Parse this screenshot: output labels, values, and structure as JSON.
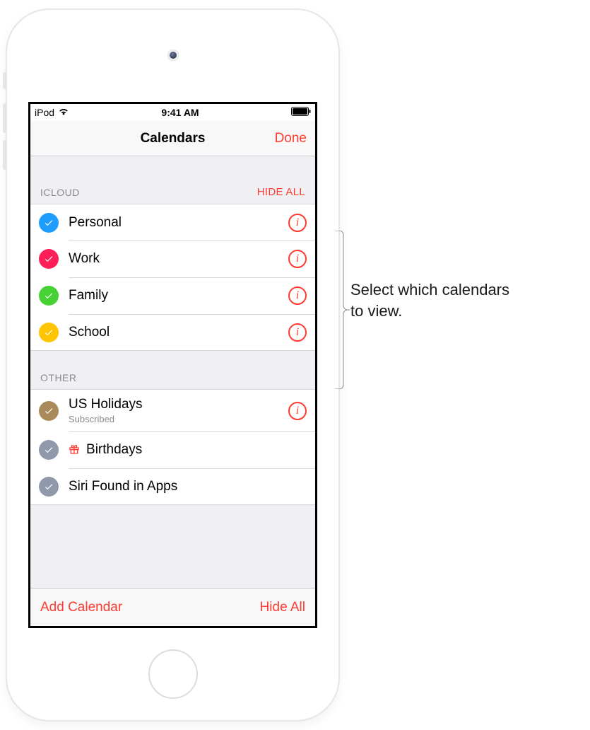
{
  "status": {
    "carrier": "iPod",
    "time": "9:41 AM"
  },
  "nav": {
    "title": "Calendars",
    "done": "Done"
  },
  "sections": {
    "icloud": {
      "label": "ICLOUD",
      "action": "HIDE ALL",
      "items": [
        {
          "name": "Personal",
          "color": "#1f9dff"
        },
        {
          "name": "Work",
          "color": "#ff1e57"
        },
        {
          "name": "Family",
          "color": "#46d235"
        },
        {
          "name": "School",
          "color": "#ffc500"
        }
      ]
    },
    "other": {
      "label": "OTHER",
      "items": [
        {
          "name": "US Holidays",
          "sub": "Subscribed",
          "color": "#aa8a5b",
          "info": true
        },
        {
          "name": "Birthdays",
          "color": "#8f99ab",
          "gift": true
        },
        {
          "name": "Siri Found in Apps",
          "color": "#8f99ab"
        }
      ]
    }
  },
  "toolbar": {
    "add": "Add Calendar",
    "hide": "Hide All"
  },
  "callout": {
    "line1": "Select which calendars",
    "line2": "to view."
  }
}
